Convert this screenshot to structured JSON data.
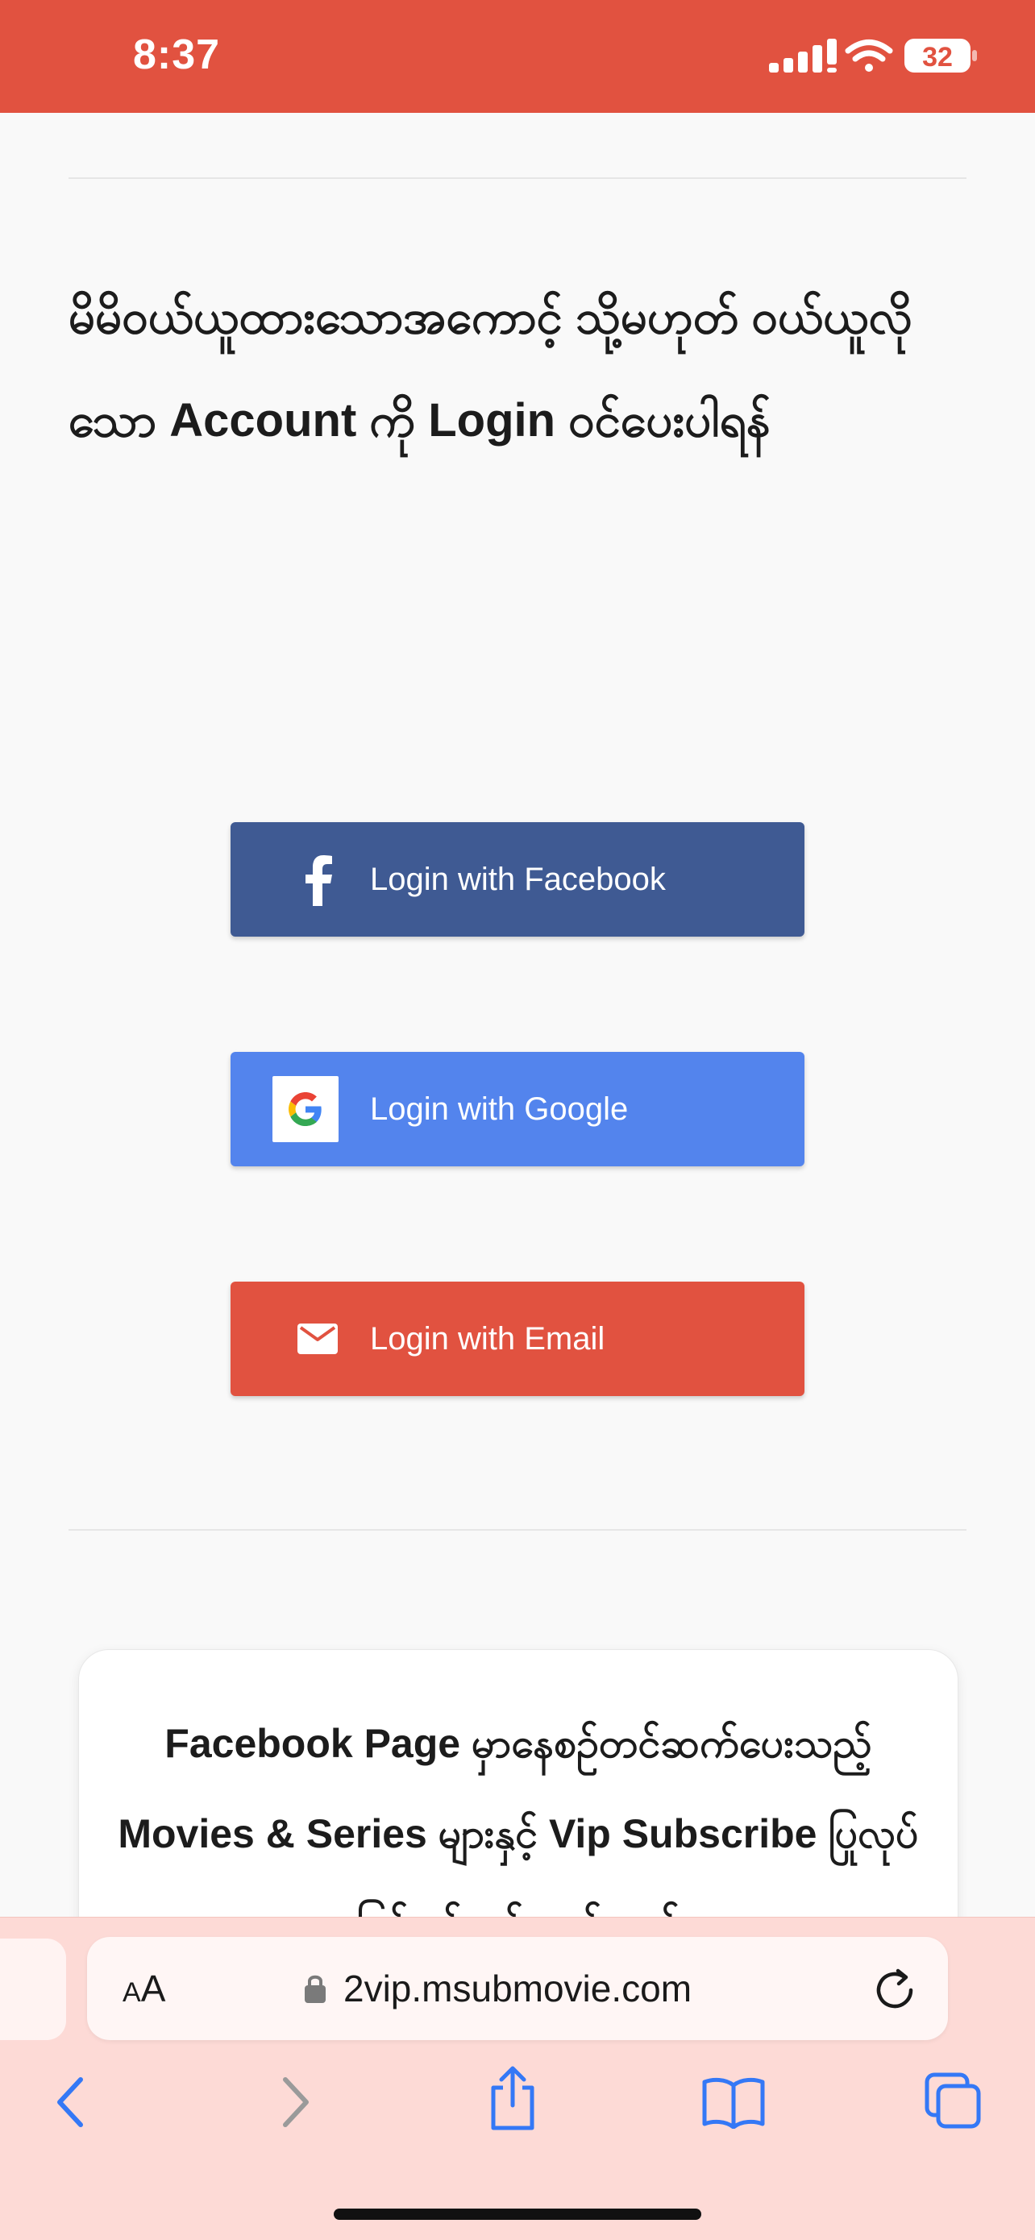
{
  "status_bar": {
    "time": "8:37",
    "battery": "32",
    "background_color": "#e15240"
  },
  "content": {
    "heading": "မိမိဝယ်ယူထားသောအကောင့် သို့မဟုတ် ဝယ်ယူလိုသော Account ကို Login ဝင်ပေးပါရန်",
    "login_buttons": [
      {
        "label": "Login with Facebook",
        "icon": "facebook-icon",
        "color": "#3f5a93"
      },
      {
        "label": "Login with Google",
        "icon": "google-icon",
        "color": "#5384ed"
      },
      {
        "label": "Login with Email",
        "icon": "email-icon",
        "color": "#e15240"
      }
    ],
    "card_text": "Facebook Page မှာနေစဉ်တင်ဆက်ပေးသည့် Movies & Series များနှင့် Vip Subscribe ပြုလုပ်ခြင်းနှင့်ပတ်သတ်သည့်"
  },
  "browser": {
    "text_size_label": "AA",
    "url": "2vip.msubmovie.com",
    "accent_color": "#3478f6",
    "toolbar": [
      "back-icon",
      "forward-icon",
      "share-icon",
      "bookmarks-icon",
      "tabs-icon"
    ]
  }
}
